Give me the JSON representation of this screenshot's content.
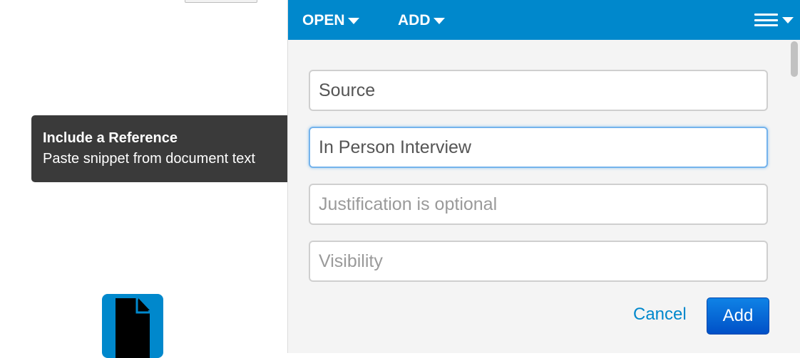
{
  "tooltip": {
    "title": "Include a Reference",
    "body": "Paste snippet from document text"
  },
  "toolbar": {
    "open_label": "OPEN",
    "add_label": "ADD",
    "menu_icon": "hamburger-menu-icon",
    "color": "#0088cc"
  },
  "form": {
    "source": {
      "value": "Source",
      "placeholder": ""
    },
    "reference": {
      "value": "In Person Interview",
      "placeholder": ""
    },
    "justification": {
      "value": "",
      "placeholder": "Justification is optional"
    },
    "visibility": {
      "value": "",
      "placeholder": "Visibility"
    }
  },
  "actions": {
    "cancel_label": "Cancel",
    "add_label": "Add"
  },
  "left": {
    "document_icon": "document-icon"
  }
}
